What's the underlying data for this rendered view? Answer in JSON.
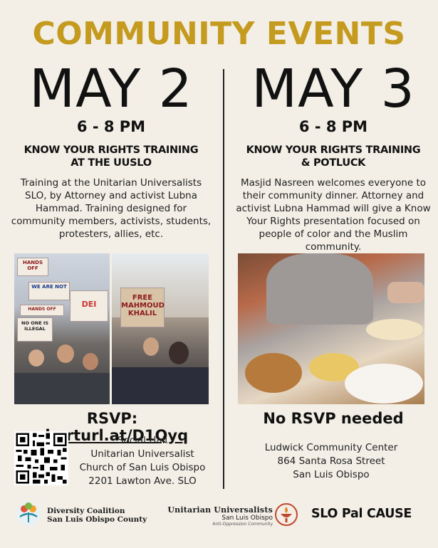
{
  "title": "COMMUNITY EVENTS",
  "events": [
    {
      "date": "MAY 2",
      "time": "6 - 8 PM",
      "event_line1": "KNOW YOUR RIGHTS TRAINING",
      "event_line2": "AT THE UUSLO",
      "description": "Training at the Unitarian Universalists SLO, by Attorney and activist Lubna Hammad. Training designed for community members, activists, students, protesters, allies, etc.",
      "rsvp_label": "RSVP: ",
      "rsvp_link": "shorturl.at/D1Qyq",
      "venue_lines": [
        "Social Hall",
        "Unitarian Universalist",
        "Church of San Luis Obispo",
        "2201 Lawton Ave. SLO"
      ],
      "photo_signs": [
        "HANDS OFF",
        "WE ARE NOT",
        "HANDS OFF",
        "NO ONE IS ILLEGAL",
        "DEI",
        "FREE MAHMOUD KHALIL"
      ]
    },
    {
      "date": "MAY 3",
      "time": "6 - 8 PM",
      "event_line1": "KNOW YOUR RIGHTS TRAINING",
      "event_line2": "& POTLUCK",
      "description": "Masjid Nasreen welcomes everyone to their community dinner. Attorney and activist Lubna Hammad will give a Know Your Rights presentation focused on people of color and the Muslim community.",
      "rsvp_text": "No RSVP needed",
      "venue_lines": [
        "Ludwick Community Center",
        "864 Santa Rosa Street",
        "San Luis Obispo"
      ]
    }
  ],
  "footer": {
    "diversity_line1": "Diversity Coalition",
    "diversity_line2": "San Luis Obispo County",
    "uu_main": "Unitarian Universalists",
    "uu_sub": "San Luis Obispo",
    "uu_sub2": "Anti-Oppression Community",
    "slo": "SLO Pal CAUSE"
  },
  "colors": {
    "title": "#c49a1f",
    "background": "#f3efe7",
    "text": "#111111"
  }
}
